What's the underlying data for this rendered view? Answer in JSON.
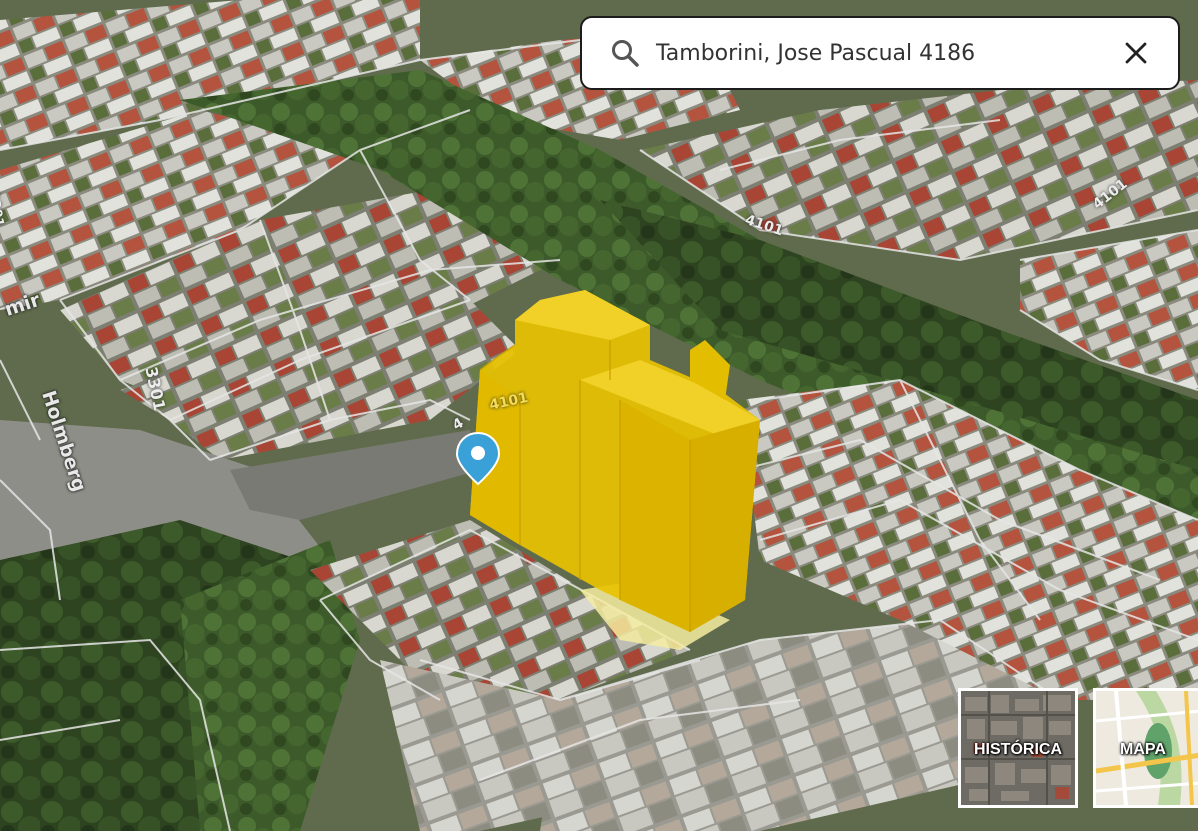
{
  "search": {
    "query": "Tamborini, Jose Pascual 4186"
  },
  "map": {
    "streets": {
      "holmberg": "Holmberg",
      "partial_left": "mir"
    },
    "numbers": {
      "n3301_left": "3301",
      "n3301_road": "3301",
      "n4101_top": "4101",
      "n4101_building": "4101",
      "n4101_right": "4101",
      "n4_road": "4"
    },
    "colors": {
      "building": "#e8c200",
      "marker": "#3aa0d8",
      "parcel_lines": "#e6e6e6"
    }
  },
  "layers": [
    {
      "label": "HISTÓRICA",
      "icon": "satellite-thumbnail"
    },
    {
      "label": "MAPA",
      "icon": "map-thumbnail"
    }
  ]
}
